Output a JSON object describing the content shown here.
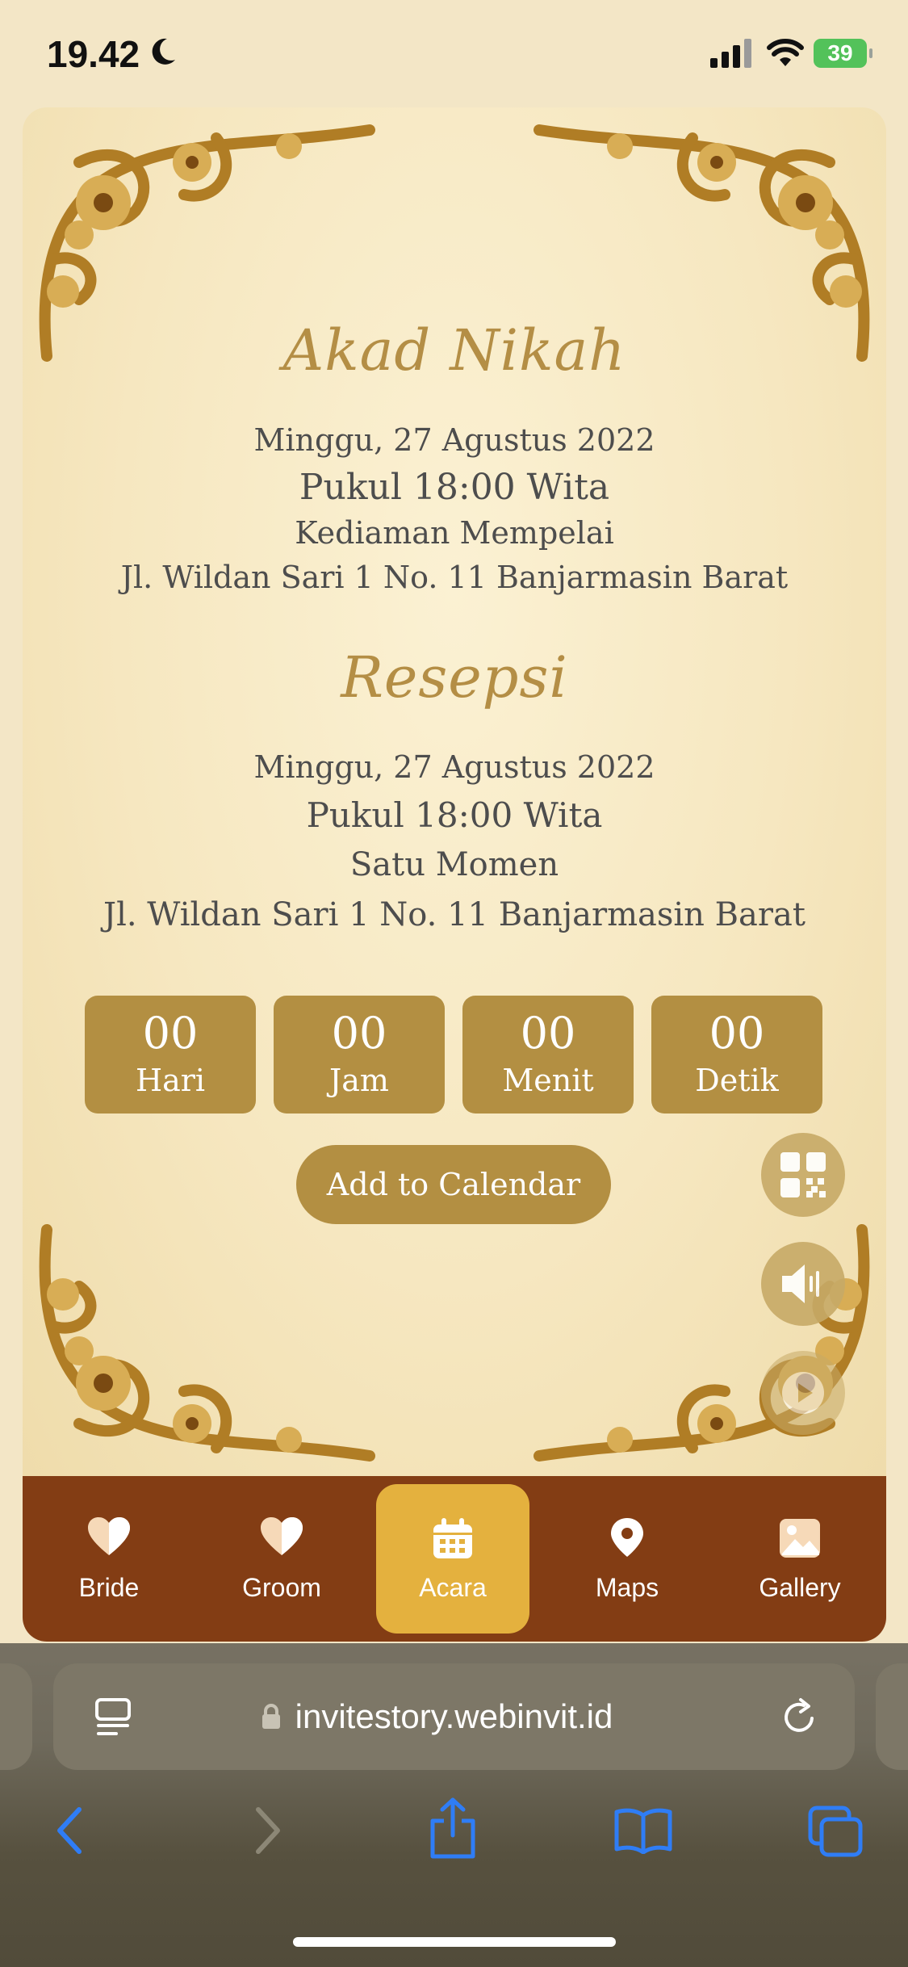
{
  "status_bar": {
    "time": "19.42",
    "battery": "39"
  },
  "akad": {
    "title": "Akad Nikah",
    "date": "Minggu, 27 Agustus 2022",
    "time": "Pukul 18:00 Wita",
    "place": "Kediaman Mempelai",
    "address": "Jl. Wildan Sari 1 No. 11 Banjarmasin Barat"
  },
  "resepsi": {
    "title": "Resepsi",
    "date": "Minggu, 27 Agustus 2022",
    "time": "Pukul 18:00 Wita",
    "place": "Satu Momen",
    "address": "Jl. Wildan Sari 1 No. 11 Banjarmasin Barat"
  },
  "countdown": [
    {
      "value": "00",
      "label": "Hari"
    },
    {
      "value": "00",
      "label": "Jam"
    },
    {
      "value": "00",
      "label": "Menit"
    },
    {
      "value": "00",
      "label": "Detik"
    }
  ],
  "calendar_button": "Add to Calendar",
  "floating_buttons": [
    "qr-code-icon",
    "speaker-icon",
    "play-icon"
  ],
  "nav": [
    {
      "label": "Bride",
      "icon": "heart-icon"
    },
    {
      "label": "Groom",
      "icon": "heart-icon"
    },
    {
      "label": "Acara",
      "icon": "calendar-icon",
      "active": true
    },
    {
      "label": "Maps",
      "icon": "map-pin-icon"
    },
    {
      "label": "Gallery",
      "icon": "image-icon"
    }
  ],
  "browser": {
    "url": "invitestory.webinvit.id"
  },
  "colors": {
    "gold": "#b38f42",
    "brown_nav": "#833d14",
    "active_nav": "#e4b13e",
    "accent_blue": "#2f7df6"
  }
}
